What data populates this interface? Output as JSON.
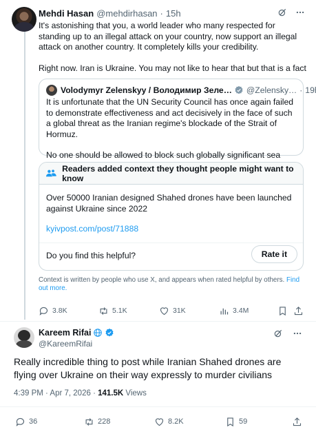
{
  "tweet_main": {
    "author_name": "Mehdi Hasan",
    "handle": "@mehdirhasan",
    "time": "15h",
    "text_p1": "It's astonishing that you, a world leader who many respected for standing up to an illegal attack on your country, now support an illegal attack on another country. It completely kills your credibility.",
    "text_p2": "Right now. Iran is Ukraine. You may not like to hear that but that is a fact",
    "quote": {
      "author_name": "Volodymyr Zelenskyy / Володимир Зеле…",
      "handle": "@Zelensky…",
      "time": "19h",
      "text_p1": "It is unfortunate that the UN Security Council has once again failed to demonstrate effectiveness and act decisively in the face of such a global threat as the Iranian regime's blockade of the Strait of Hormuz.",
      "text_p2": "No one should be allowed to block such globally significant sea"
    },
    "note": {
      "title": "Readers added context they thought people might want to know",
      "text": "Over 50000 Iranian designed Shahed drones have been launched against Ukraine since 2022",
      "link": "kyivpost.com/post/71888",
      "helpful_question": "Do you find this helpful?",
      "rate_button": "Rate it"
    },
    "disclaimer": "Context is written by people who use X, and appears when rated helpful by others.",
    "disclaimer_link": "Find out more.",
    "stats": {
      "replies": "3.8K",
      "reposts": "5.1K",
      "likes": "31K",
      "views": "3.4M"
    }
  },
  "tweet_reply": {
    "author_name": "Kareem Rifai",
    "handle": "@KareemRifai",
    "text": "Really incredible thing to post while Iranian Shahed drones are flying over Ukraine on their way expressly to murder civilians",
    "time": "4:39 PM · Apr 7, 2026 · ",
    "views_count": "141.5K",
    "views_label": " Views",
    "stats": {
      "replies": "36",
      "reposts": "228",
      "likes": "8.2K",
      "bookmarks": "59"
    }
  },
  "colors": {
    "accent": "#1d9bf0",
    "muted": "#536471",
    "border": "#cfd9de",
    "text": "#0f1419"
  }
}
